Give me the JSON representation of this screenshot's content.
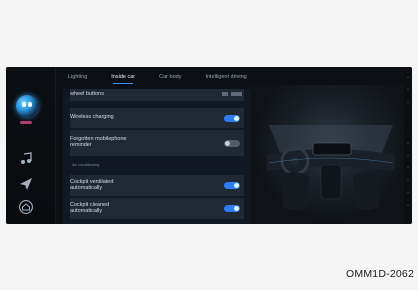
{
  "tabs": [
    {
      "label": "Lighting",
      "active": false
    },
    {
      "label": "Inside car",
      "active": true
    },
    {
      "label": "Car body",
      "active": false
    },
    {
      "label": "Intelligent driving",
      "active": false
    }
  ],
  "settings": {
    "rows": [
      {
        "label": "wheel buttons",
        "toggle": null
      },
      {
        "label": "Wireless charging",
        "toggle": "on"
      },
      {
        "label": "Forgotten mobilephone\nreminder",
        "toggle": "off"
      }
    ],
    "section_title": "Air conditioning",
    "section_rows": [
      {
        "label": "Cockpit ventilated\nautomatically",
        "toggle": "on"
      },
      {
        "label": "Cockpit cleaned\nautomatically",
        "toggle": "on"
      }
    ]
  },
  "caption": "OMM1D-2062",
  "icons": {
    "assistant": "assistant-avatar-icon",
    "music": "music-note-icon",
    "navigation": "navigation-arrow-icon",
    "home": "home-icon"
  },
  "colors": {
    "accent": "#2e7df2",
    "screen_bg": "#0c0f14",
    "panel_bg": "#121821"
  }
}
